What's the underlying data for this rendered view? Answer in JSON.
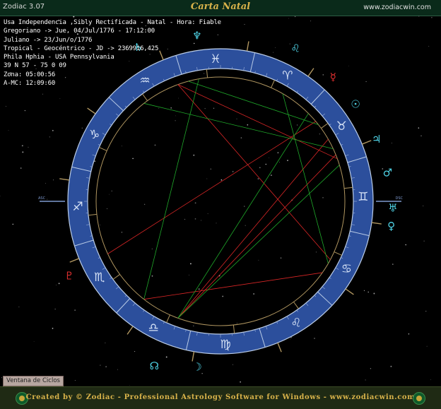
{
  "window": {
    "app_version": "Zodiac 3.07",
    "title": "Carta Natal",
    "website": "www.zodiacwin.com"
  },
  "info_lines": [
    "Usa Independencia ,Sibly Rectificada - Natal - Hora: Fiable",
    "Gregoriano -> Jue, 04/Jul/1776 - 17:12:00",
    "Juliano -> 23/Jun/o/1776",
    "Tropical - Geocéntrico - JD -> 2369916,425",
    "Phila Hphia - USA Pennsylvania",
    "39 N 57 - 75 0 09",
    "Zona:  05:00:56",
    "A-MC: 12:09:60"
  ],
  "wheel": {
    "sign_symbols": [
      "♊",
      "♉",
      "♈",
      "♓",
      "♒",
      "♑",
      "♐",
      "♏",
      "♎",
      "♍",
      "♌",
      "♋"
    ],
    "axis_labels": [
      "ASC",
      "DSC"
    ],
    "planets": [
      {
        "name": "Neptune",
        "glyph": "♆",
        "color": "#4fd3e6"
      },
      {
        "name": "Saturn",
        "glyph": "♄",
        "color": "#4fd3e6"
      },
      {
        "name": "Leo marker",
        "glyph": "♌",
        "color": "#4fd3e6"
      },
      {
        "name": "Pluto",
        "glyph": "♇",
        "color": "#e63030"
      },
      {
        "name": "Moon",
        "glyph": "☽",
        "color": "#4fd3e6"
      },
      {
        "name": "Mercury",
        "glyph": "☿",
        "color": "#e63030"
      },
      {
        "name": "Sun",
        "glyph": "☉",
        "color": "#4fd3e6"
      },
      {
        "name": "Jupiter",
        "glyph": "♃",
        "color": "#4fd3e6"
      },
      {
        "name": "Mars",
        "glyph": "♂",
        "color": "#4fd3e6"
      },
      {
        "name": "Uranus",
        "glyph": "♅",
        "color": "#4fd3e6"
      },
      {
        "name": "Venus",
        "glyph": "♀",
        "color": "#4fd3e6"
      },
      {
        "name": "Node",
        "glyph": "☊",
        "color": "#4fd3e6"
      }
    ],
    "colors": {
      "band": "#2c4f9c",
      "ring_line": "#b9cbe6",
      "tan_line": "#b09660",
      "red_aspect": "#d92626",
      "green_aspect": "#1faa2a"
    }
  },
  "button_ventana": "Ventana de Ciclos",
  "footer_text": "Created by © Zodiac - Professional Astrology Software for Windows - www.zodiacwin.com"
}
